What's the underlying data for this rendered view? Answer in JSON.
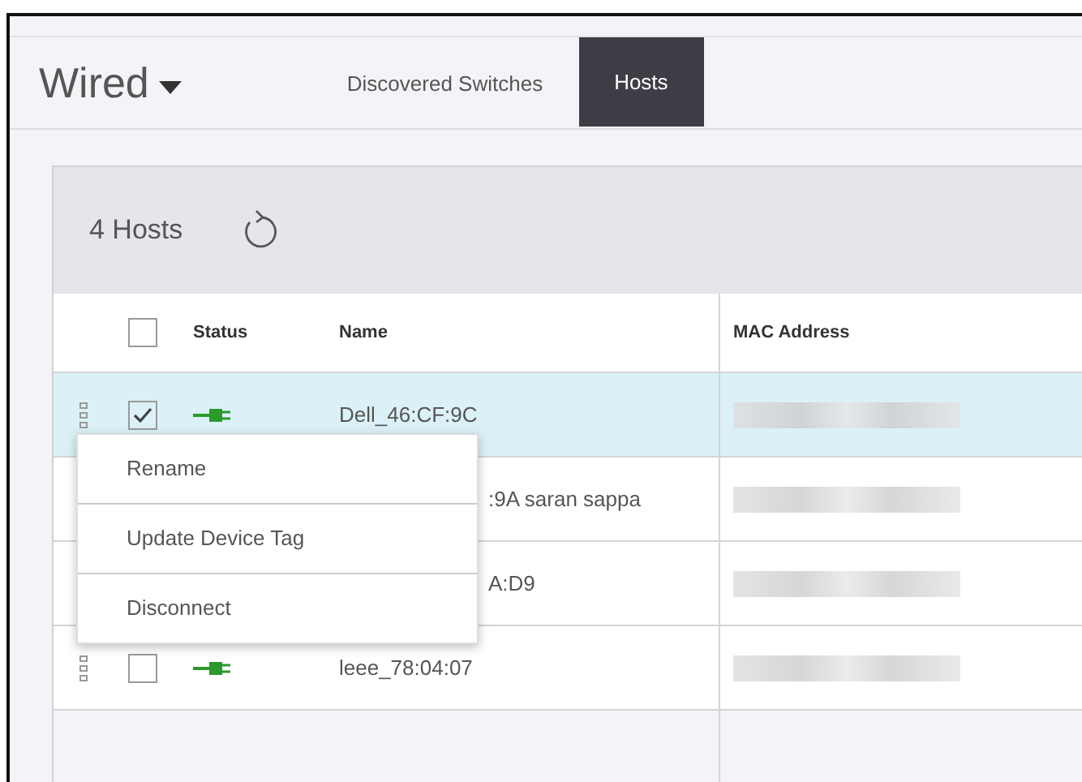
{
  "header": {
    "title": "Wired",
    "tabs": [
      {
        "label": "Discovered Switches",
        "selected": false
      },
      {
        "label": "Hosts",
        "selected": true
      }
    ]
  },
  "toolbar": {
    "count": "4 Hosts"
  },
  "table": {
    "columns": [
      "Status",
      "Name",
      "MAC Address"
    ],
    "select_all_checked": false,
    "rows": [
      {
        "name": "Dell_46:CF:9C",
        "selected": true,
        "checked": true,
        "kind": "connected"
      },
      {
        "name": ":9A saran sappa",
        "selected": false,
        "covered": true
      },
      {
        "name": "A:D9",
        "selected": false,
        "covered": true
      },
      {
        "name": "leee_78:04:07",
        "selected": false,
        "checked": false,
        "kind": "connected"
      }
    ]
  },
  "context_menu": {
    "items": [
      "Rename",
      "Update Device Tag",
      "Disconnect"
    ]
  }
}
